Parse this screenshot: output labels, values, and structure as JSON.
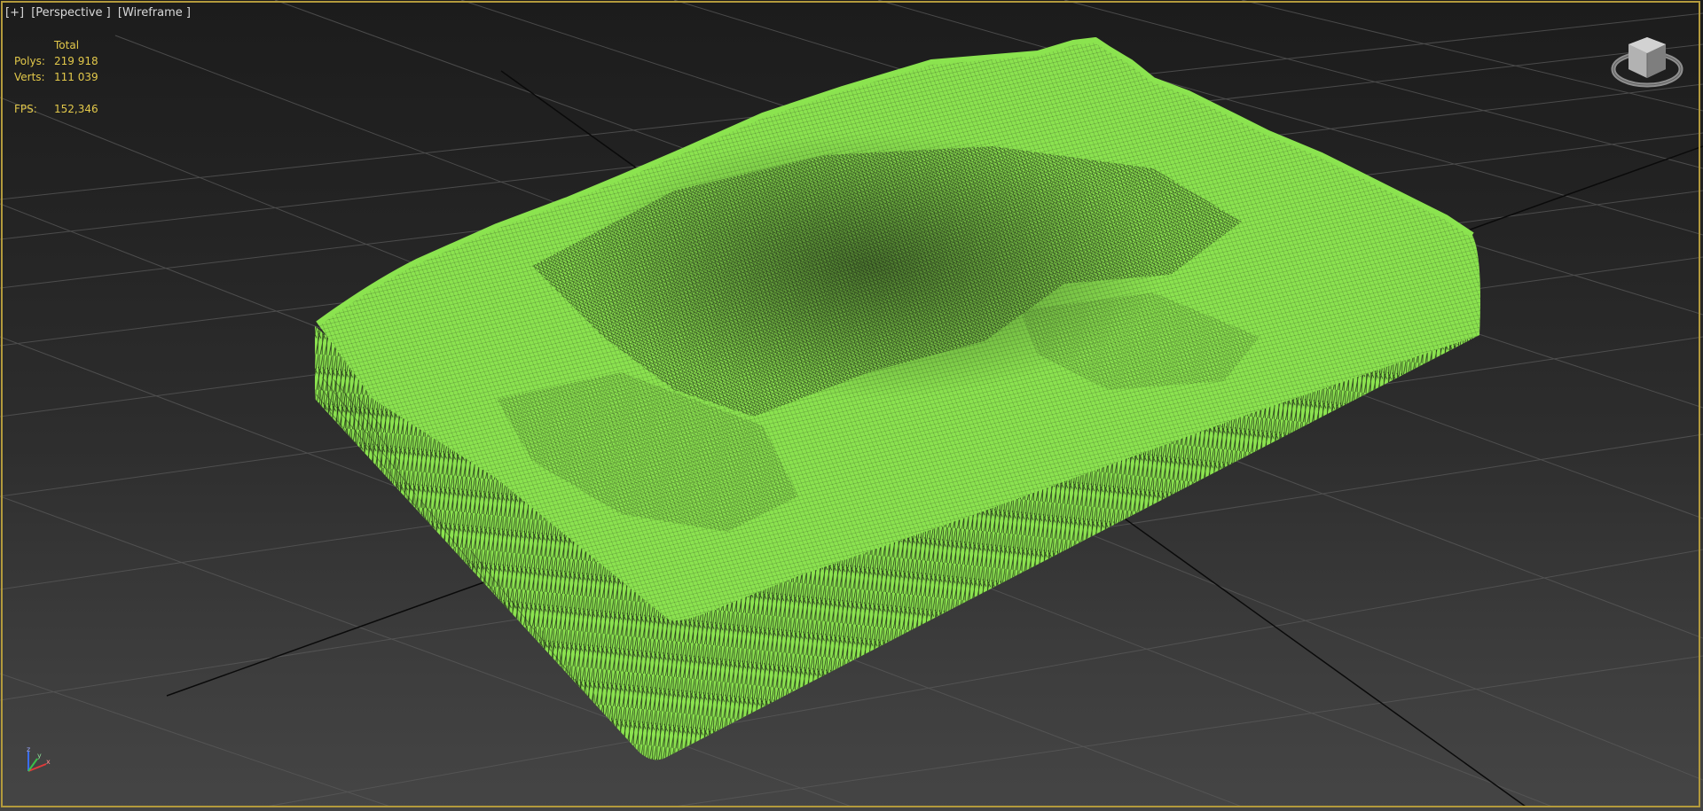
{
  "viewport": {
    "label": {
      "plus": "[+]",
      "view": "[Perspective ]",
      "shading": "[Wireframe ]"
    },
    "stats": {
      "column_header": "Total",
      "polys_label": "Polys:",
      "polys_value": "219 918",
      "verts_label": "Verts:",
      "verts_value": "111 039",
      "fps_label": "FPS:",
      "fps_value": "152,346"
    },
    "axis_labels": {
      "x": "x",
      "y": "y",
      "z": "z"
    }
  },
  "colors": {
    "viewport_border": "#b39a3c",
    "stats_text": "#e2c84a",
    "label_text": "#d8d8d8",
    "mesh_fill": "#8be34f",
    "mesh_wire_dark": "#2a3a20",
    "grid_line": "#5a5a5a",
    "world_axis_line": "#0a0a0a"
  },
  "icons": [
    "viewcube-icon",
    "axis-tripod-icon"
  ]
}
